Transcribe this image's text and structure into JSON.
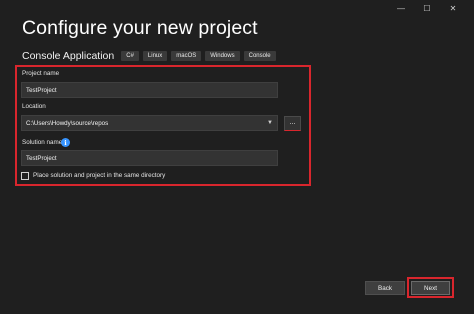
{
  "window_controls": {
    "minimize": "—",
    "maximize": "☐",
    "close": "✕"
  },
  "page": {
    "title": "Configure your new project",
    "app_type": "Console Application",
    "tags": [
      "C#",
      "Linux",
      "macOS",
      "Windows",
      "Console"
    ]
  },
  "form": {
    "project_name_label": "Project name",
    "project_name_value": "TestProject",
    "location_label": "Location",
    "location_value": "C:\\Users\\Howdy\\source\\repos",
    "browse_label": "...",
    "solution_name_label": "Solution name",
    "solution_name_value": "TestProject",
    "same_directory_label": "Place solution and project in the same directory",
    "same_directory_checked": false
  },
  "footer": {
    "back_label": "Back",
    "next_label": "Next"
  },
  "colors": {
    "background": "#1f1f1f",
    "highlight": "#d9262d",
    "info": "#3794ff"
  },
  "icons": {
    "info": "info-icon",
    "dropdown": "chevron-down-icon"
  }
}
